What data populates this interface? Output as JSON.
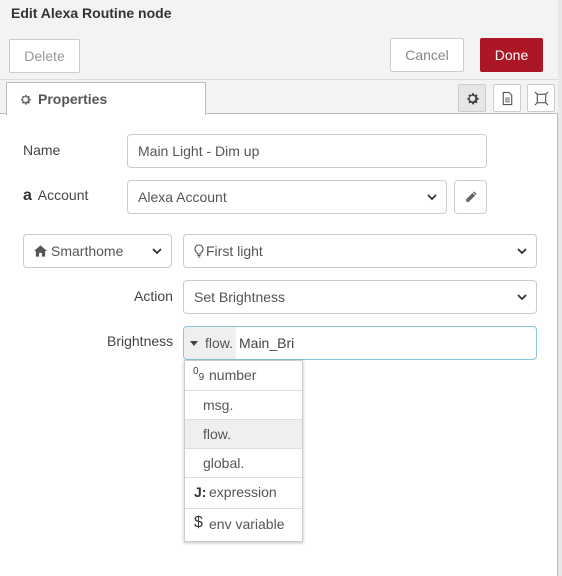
{
  "header": {
    "title": "Edit Alexa Routine node",
    "delete_label": "Delete",
    "cancel_label": "Cancel",
    "done_label": "Done",
    "done_color": "#ad1625"
  },
  "tabs": {
    "properties_label": "Properties"
  },
  "form": {
    "name_label": "Name",
    "name_value": "Main Light - Dim up",
    "account_label": "Account",
    "account_icon_glyph": "a",
    "account_value": "Alexa Account",
    "smarthome_value": "Smarthome",
    "device_value": "First light",
    "action_label": "Action",
    "action_value": "Set Brightness",
    "brightness_label": "Brightness",
    "brightness_type_prefix": "flow.",
    "brightness_value": "Main_Bri",
    "input_focus_color": "#85c6d8"
  },
  "type_menu": {
    "items": [
      {
        "label": "number",
        "icon": "number-icon",
        "icon_text": "0",
        "icon_sub": "9"
      },
      {
        "label": "msg.",
        "icon": ""
      },
      {
        "label": "flow.",
        "icon": "",
        "selected": true
      },
      {
        "label": "global.",
        "icon": ""
      },
      {
        "label": "expression",
        "icon": "jsonata-icon",
        "icon_text": "J:"
      },
      {
        "label": "env variable",
        "icon": "dollar-icon",
        "icon_text": "$"
      }
    ]
  }
}
